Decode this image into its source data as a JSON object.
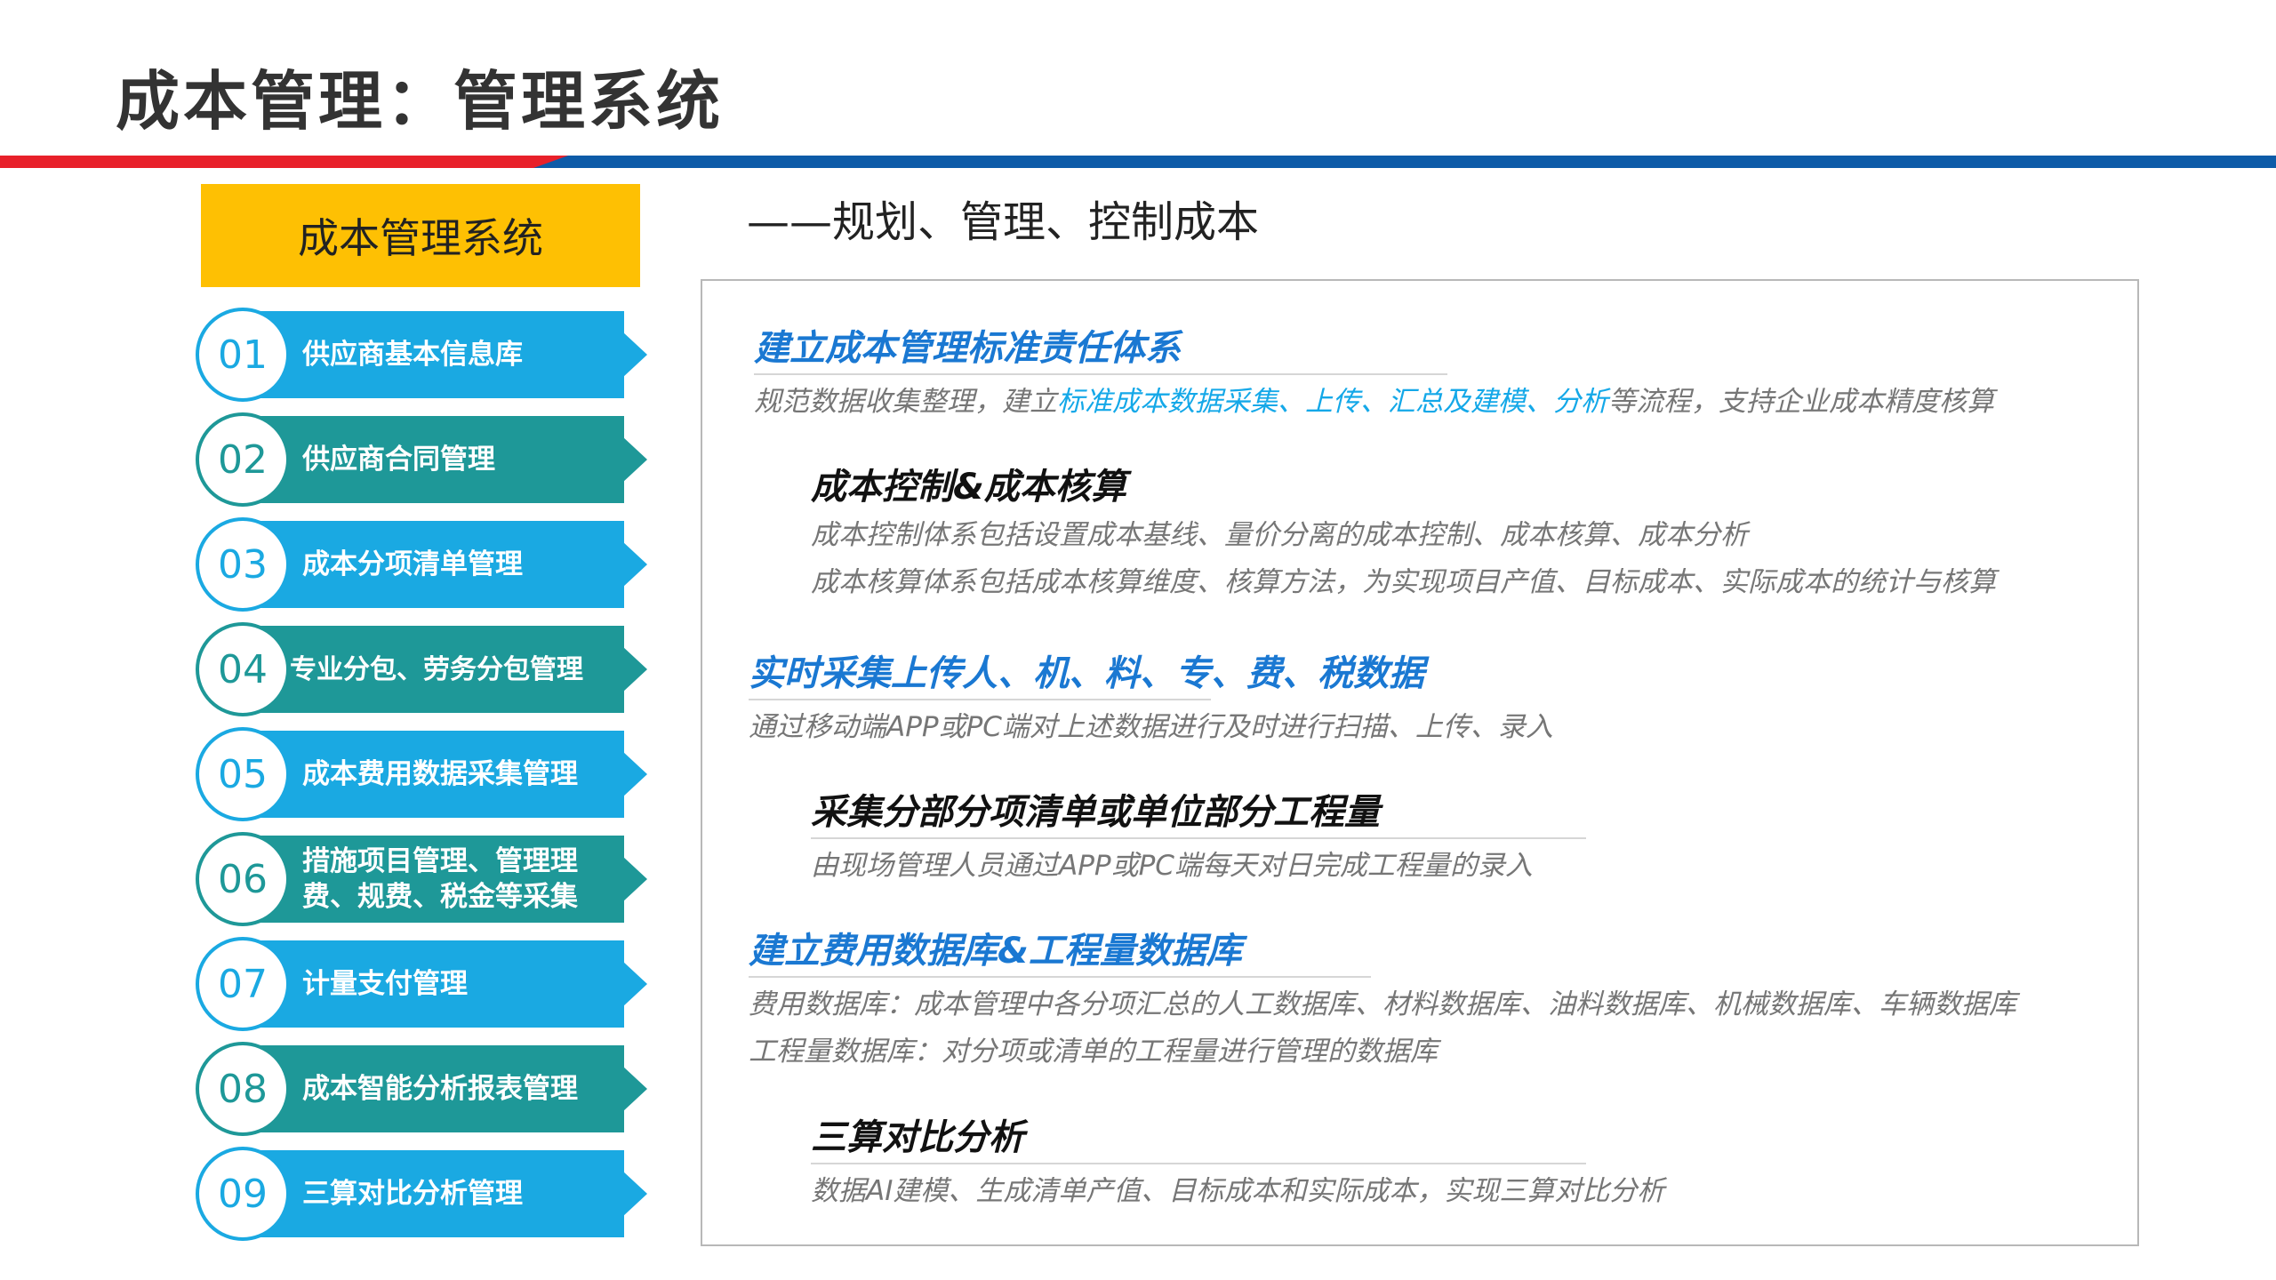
{
  "page": {
    "title": "成本管理：管理系统",
    "subtitle": "——规划、管理、控制成本"
  },
  "colors": {
    "red": "#e8202a",
    "blue": "#0d5ba8",
    "yellow": "#fec003",
    "cyan": "#1aa9e2",
    "teal": "#1e9898"
  },
  "system": {
    "title": "成本管理系统"
  },
  "menu": [
    {
      "num": "01",
      "label": "供应商基本信息库",
      "color": "#1aa9e2"
    },
    {
      "num": "02",
      "label": "供应商合同管理",
      "color": "#1e9898"
    },
    {
      "num": "03",
      "label": "成本分项清单管理",
      "color": "#1aa9e2"
    },
    {
      "num": "04",
      "label": "专业分包、劳务分包管理",
      "color": "#1e9898"
    },
    {
      "num": "05",
      "label": "成本费用数据采集管理",
      "color": "#1aa9e2"
    },
    {
      "num": "06",
      "label": "措施项目管理、管理理费、规费、税金等采集",
      "color": "#1e9898"
    },
    {
      "num": "07",
      "label": "计量支付管理",
      "color": "#1aa9e2"
    },
    {
      "num": "08",
      "label": "成本智能分析报表管理",
      "color": "#1e9898"
    },
    {
      "num": "09",
      "label": "三算对比分析管理",
      "color": "#1aa9e2"
    }
  ],
  "sections": {
    "s1": {
      "heading": "建立成本管理标准责任体系",
      "desc_pre": "规范数据收集整理，建立",
      "desc_hl": "标准成本数据采集、上传、汇总及建模、分析",
      "desc_post": "等流程，支持企业成本精度核算"
    },
    "s2": {
      "heading": "成本控制&成本核算",
      "line1": "成本控制体系包括设置成本基线、量价分离的成本控制、成本核算、成本分析",
      "line2": "成本核算体系包括成本核算维度、核算方法，为实现项目产值、目标成本、实际成本的统计与核算"
    },
    "s3": {
      "heading": "实时采集上传人、机、料、专、费、税数据",
      "line1": "通过移动端APP或PC端对上述数据进行及时进行扫描、上传、录入"
    },
    "s4": {
      "heading": "采集分部分项清单或单位部分工程量",
      "line1": "由现场管理人员通过APP或PC端每天对日完成工程量的录入"
    },
    "s5": {
      "heading": "建立费用数据库&工程量数据库",
      "line1": "费用数据库：成本管理中各分项汇总的人工数据库、材料数据库、油料数据库、机械数据库、车辆数据库",
      "line2": "工程量数据库：对分项或清单的工程量进行管理的数据库"
    },
    "s6": {
      "heading": "三算对比分析",
      "line1": "数据AI建模、生成清单产值、目标成本和实际成本，实现三算对比分析"
    }
  }
}
